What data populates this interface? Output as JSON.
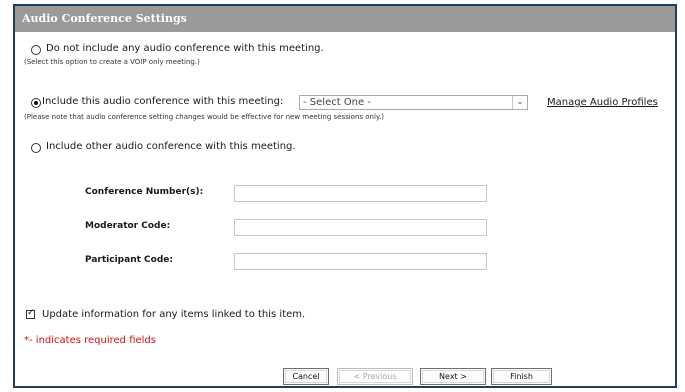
{
  "panel": {
    "title": "Audio Conference Settings"
  },
  "options": {
    "none": {
      "label": "Do not include any audio conference with this meeting.",
      "note": "(Select this option to create a VOIP only meeting.)",
      "selected": false
    },
    "include": {
      "label": "Include this audio conference with this meeting:",
      "select_value": "- Select One -",
      "note": "(Please note that audio conference setting changes would be effective for new meeting sessions only.)",
      "selected": true
    },
    "other": {
      "label": "Include other audio conference with this meeting.",
      "selected": false
    }
  },
  "manage_link": "Manage Audio Profiles",
  "fields": {
    "conference_number": {
      "label": "Conference Number(s):",
      "value": ""
    },
    "moderator_code": {
      "label": "Moderator Code:",
      "value": ""
    },
    "participant_code": {
      "label": "Participant Code:",
      "value": ""
    }
  },
  "update_checkbox": {
    "label": "Update information for any items linked to this item.",
    "checked": true
  },
  "required_note": "*- indicates required fields",
  "buttons": {
    "cancel": "Cancel",
    "previous": "< Previous",
    "next": "Next >",
    "finish": "Finish"
  },
  "colors": {
    "titlebar": "#9a9a9a",
    "border": "#1f3f5c",
    "required": "#cc1111"
  }
}
